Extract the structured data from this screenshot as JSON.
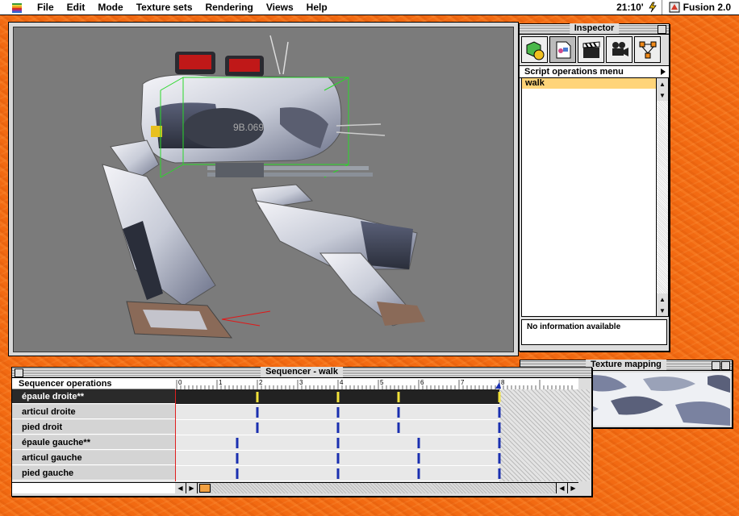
{
  "menubar": {
    "menus": [
      "File",
      "Edit",
      "Mode",
      "Texture sets",
      "Rendering",
      "Views",
      "Help"
    ],
    "clock": "21:10'",
    "app_name": "Fusion 2.0"
  },
  "viewport": {
    "model_label": "9B.069"
  },
  "inspector": {
    "title": "Inspector",
    "tool_icons": [
      "cube-sphere-icon",
      "script-page-icon",
      "clapperboard-icon",
      "camera-icon",
      "hierarchy-icon"
    ],
    "script_menu_label": "Script operations menu",
    "scripts": [
      "walk"
    ],
    "selected_script": "walk",
    "info_text": "No information available"
  },
  "sequencer": {
    "title": "Sequencer - walk",
    "header_label": "Sequencer operations",
    "ruler_labels": [
      "0",
      "1",
      "2",
      "3",
      "4",
      "5",
      "6",
      "7",
      "8"
    ],
    "tracks": [
      {
        "name": "épaule droite**",
        "selected": true,
        "keys": [
          2,
          4,
          5.5,
          8
        ]
      },
      {
        "name": "articul droite",
        "selected": false,
        "keys": [
          2,
          4,
          5.5,
          8
        ]
      },
      {
        "name": "pied droit",
        "selected": false,
        "keys": [
          2,
          4,
          5.5,
          8
        ]
      },
      {
        "name": "épaule gauche**",
        "selected": false,
        "keys": [
          1.5,
          4,
          6,
          8
        ]
      },
      {
        "name": "articul gauche",
        "selected": false,
        "keys": [
          1.5,
          4,
          6,
          8
        ]
      },
      {
        "name": "pied gauche",
        "selected": false,
        "keys": [
          1.5,
          4,
          6,
          8
        ]
      }
    ],
    "playhead": 8,
    "colors": {
      "key_selected": "#f2e23a",
      "key_normal": "#1a2fb0",
      "playhead": "#1a2fb0"
    }
  },
  "texture": {
    "title": "Texture mapping"
  }
}
